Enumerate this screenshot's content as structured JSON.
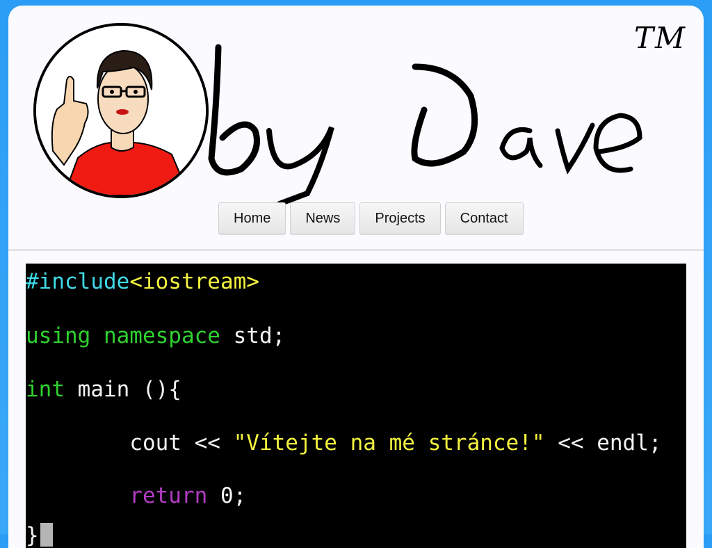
{
  "header": {
    "logo_text": "by Dave",
    "trademark": "TM",
    "avatar_icon": "avatar-cartoon-thumbs-up"
  },
  "nav": {
    "items": [
      {
        "label": "Home"
      },
      {
        "label": "News"
      },
      {
        "label": "Projects"
      },
      {
        "label": "Contact"
      }
    ]
  },
  "code": {
    "line1_directive": "#include",
    "line1_header": "<iostream>",
    "line2_kw": "using namespace",
    "line2_rest": " std;",
    "line3_kw": "int",
    "line3_rest": " main (){",
    "line4_indent": "        ",
    "line4_cout": "cout << ",
    "line4_string": "\"Vítejte na mé stránce!\"",
    "line4_rest": " << endl;",
    "line5_indent": "        ",
    "line5_kw": "return",
    "line5_rest": " 0;",
    "line6_brace": "}"
  },
  "colors": {
    "page_bg": "#2b9df4",
    "card_bg": "#fbfbff",
    "terminal_bg": "#000000",
    "directive": "#3fd9e6",
    "string": "#f3f340",
    "keyword": "#2fd12f",
    "return_kw": "#b13cc2"
  }
}
